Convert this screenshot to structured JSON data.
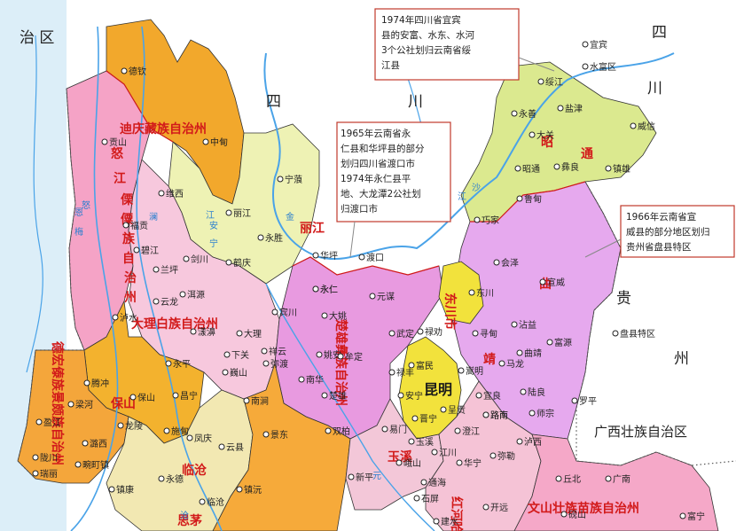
{
  "regions": {
    "tibet": "治 区",
    "sichuan_1": "四",
    "sichuan_2": "川",
    "sichuan_ne": "四",
    "sichuan_e": "川",
    "guizhou_1": "贵",
    "guizhou_2": "州",
    "guangxi": "广西壮族自治区"
  },
  "prefectures": {
    "diqing_a": "迪庆藏族自治州",
    "nujiang_a": "怒",
    "nujiang_b": "江",
    "nujiang_c": "傈",
    "nujiang_d": "僳",
    "nujiang_e": "族",
    "nujiang_f": "自",
    "nujiang_g": "治",
    "nujiang_h": "州",
    "dali": "大理白族自治州",
    "lijiang": "丽江",
    "chuxiong_a": "楚雄彝族自治州",
    "zhaotong": "昭",
    "zhaotong_b": "通",
    "qujing_a": "曲",
    "qujing_b": "靖",
    "dongchuan": "东川市",
    "kunming": "昆明",
    "baoshan": "保山",
    "dehong": "德宏傣族景颇族自治州",
    "yuxi": "玉溪",
    "honghe": "红河哈尼",
    "wenshan": "文山壮族苗族自治州",
    "lincang": "临沧",
    "simao": "思茅"
  },
  "annotations": {
    "a1974": [
      "1974年四川省宜宾",
      "县的安富、水东、水河",
      "3个公社划归云南省绥",
      "江县"
    ],
    "a1965": [
      "1965年云南省永",
      "仁县和华坪县的部分",
      "划归四川省渡口市",
      "1974年永仁县平",
      "地、大龙潭2公社划",
      "归渡口市"
    ],
    "a1966": [
      "1966年云南省宣",
      "威县的部分地区划归",
      "贵州省盘县特区"
    ]
  },
  "cities": [
    {
      "name": "德钦"
    },
    {
      "name": "中甸"
    },
    {
      "name": "贡山"
    },
    {
      "name": "维西"
    },
    {
      "name": "福贡"
    },
    {
      "name": "碧江"
    },
    {
      "name": "兰坪"
    },
    {
      "name": "泸水"
    },
    {
      "name": "剑川"
    },
    {
      "name": "丽江"
    },
    {
      "name": "宁蒗"
    },
    {
      "name": "永胜"
    },
    {
      "name": "华坪"
    },
    {
      "name": "鹤庆"
    },
    {
      "name": "洱源"
    },
    {
      "name": "云龙"
    },
    {
      "name": "漾濞"
    },
    {
      "name": "大理"
    },
    {
      "name": "宾川"
    },
    {
      "name": "祥云"
    },
    {
      "name": "弥渡"
    },
    {
      "name": "永平"
    },
    {
      "name": "下关"
    },
    {
      "name": "巍山"
    },
    {
      "name": "南涧"
    },
    {
      "name": "保山"
    },
    {
      "name": "腾冲"
    },
    {
      "name": "昌宁"
    },
    {
      "name": "施甸"
    },
    {
      "name": "龙陵"
    },
    {
      "name": "梁河"
    },
    {
      "name": "盈江"
    },
    {
      "name": "潞西"
    },
    {
      "name": "陇川"
    },
    {
      "name": "瑞丽"
    },
    {
      "name": "畹町镇"
    },
    {
      "name": "凤庆"
    },
    {
      "name": "云县"
    },
    {
      "name": "永德"
    },
    {
      "name": "镇康"
    },
    {
      "name": "临沧"
    },
    {
      "name": "景东"
    },
    {
      "name": "镇沅"
    },
    {
      "name": "永仁"
    },
    {
      "name": "元谋"
    },
    {
      "name": "大姚"
    },
    {
      "name": "姚安"
    },
    {
      "name": "牟定"
    },
    {
      "name": "南华"
    },
    {
      "name": "楚雄"
    },
    {
      "name": "武定"
    },
    {
      "name": "禄丰"
    },
    {
      "name": "易门"
    },
    {
      "name": "双柏"
    },
    {
      "name": "渡口"
    },
    {
      "name": "永仁"
    },
    {
      "name": "巧家"
    },
    {
      "name": "会泽"
    },
    {
      "name": "东川"
    },
    {
      "name": "宣威"
    },
    {
      "name": "寻甸"
    },
    {
      "name": "沾益"
    },
    {
      "name": "富源"
    },
    {
      "name": "曲靖"
    },
    {
      "name": "马龙"
    },
    {
      "name": "陆良"
    },
    {
      "name": "罗平"
    },
    {
      "name": "师宗"
    },
    {
      "name": "禄劝"
    },
    {
      "name": "嵩明"
    },
    {
      "name": "富民"
    },
    {
      "name": "安宁"
    },
    {
      "name": "呈贡"
    },
    {
      "name": "宜良"
    },
    {
      "name": "路南"
    },
    {
      "name": "晋宁"
    },
    {
      "name": "澄江"
    },
    {
      "name": "玉溪"
    },
    {
      "name": "江川"
    },
    {
      "name": "华宁"
    },
    {
      "name": "峨山"
    },
    {
      "name": "新平"
    },
    {
      "name": "通海"
    },
    {
      "name": "石屏"
    },
    {
      "name": "建水"
    },
    {
      "name": "开远"
    },
    {
      "name": "弥勒"
    },
    {
      "name": "泸西"
    },
    {
      "name": "丘北"
    },
    {
      "name": "广南"
    },
    {
      "name": "砚山"
    },
    {
      "name": "富宁"
    },
    {
      "name": "盘县特区"
    },
    {
      "name": "镇雄"
    },
    {
      "name": "威信"
    },
    {
      "name": "彝良"
    },
    {
      "name": "盐津"
    },
    {
      "name": "大关"
    },
    {
      "name": "永善"
    },
    {
      "name": "绥江"
    },
    {
      "name": "水富区"
    },
    {
      "name": "宜宾"
    },
    {
      "name": "昭通"
    },
    {
      "name": "鲁甸"
    },
    {
      "name": "路南"
    }
  ],
  "rivers": {
    "lancang": "澜",
    "nu": "怒",
    "jinsha": "金",
    "jinsha2": "沙",
    "jinsha3": "江",
    "lancang2": "沧",
    "yuan": "元",
    "an": "安",
    "ning": "宁",
    "en_mei": "恩",
    "mei": "梅",
    "yang": "江"
  },
  "colors": {
    "sea": "#cfe8f6",
    "diqing": "#f2a82c",
    "nujiang": "#f5a3c6",
    "dali": "#f7c8dd",
    "lijiang": "#eef2b4",
    "chuxiong": "#e89ae0",
    "zhaotong": "#dbe98f",
    "qujing": "#e6a9ee",
    "kunming": "#f2e23c",
    "baoshan": "#f3b22e",
    "dehong": "#f4a63b",
    "yuxi": "#f3c7d8",
    "honghe": "#f5c3d6",
    "wenshan": "#f5a8c8",
    "lincang": "#f2e8b2",
    "simao": "#f6aa3a",
    "outside": "#ffffff",
    "border_red": "#d21a1a",
    "river": "#4aa3e8"
  }
}
